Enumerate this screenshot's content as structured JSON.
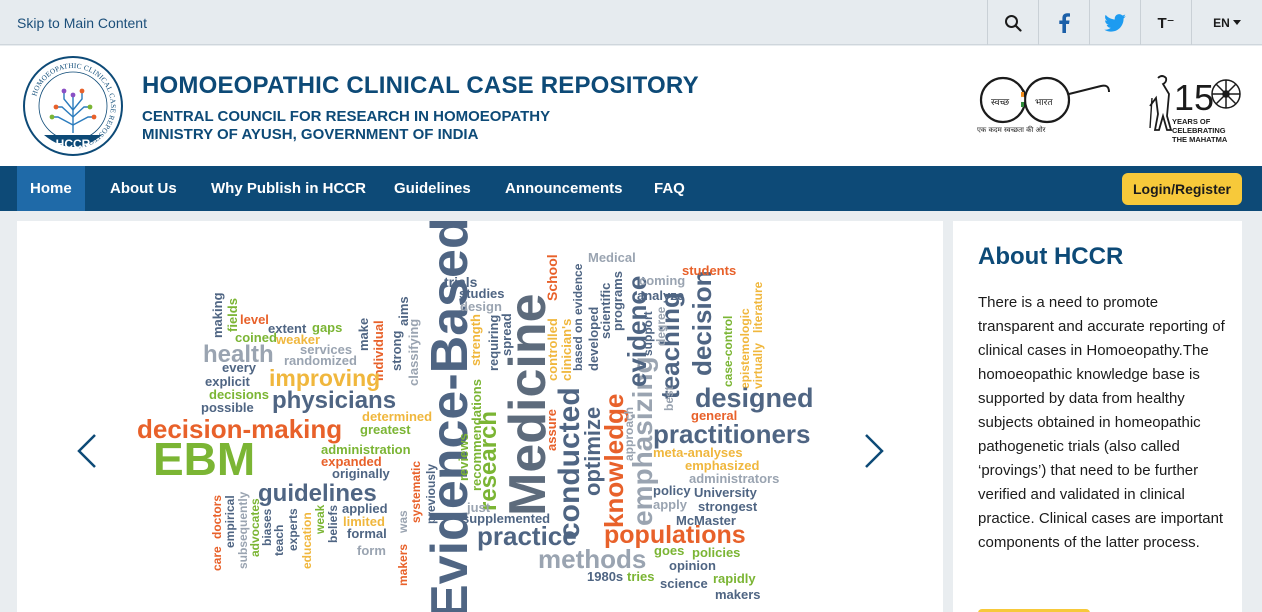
{
  "topbar": {
    "skip_link": "Skip to Main Content",
    "font_size_label": "T⁻",
    "language": "EN",
    "icons": [
      "search-icon",
      "facebook-icon",
      "twitter-icon",
      "font-size-icon",
      "chevron-down-icon"
    ]
  },
  "header": {
    "logo_text": "HCCR",
    "logo_ring_text": "HOMOEOPATHIC CLINICAL CASE REPOSITORY",
    "title": "HOMOEOPATHIC CLINICAL CASE REPOSITORY",
    "subtitle1": "CENTRAL COUNCIL FOR RESEARCH IN HOMOEOPATHY",
    "subtitle2": "MINISTRY OF AYUSH, GOVERNMENT OF INDIA",
    "swachh_left": "स्वच्छ",
    "swachh_right": "भारत",
    "swachh_tagline": "एक कदम स्वच्छता की ओर",
    "gandhi_num": "150",
    "gandhi_text1": "YEARS OF",
    "gandhi_text2": "CELEBRATING",
    "gandhi_text3": "THE MAHATMA"
  },
  "nav": {
    "items": [
      "Home",
      "About Us",
      "Why Publish in HCCR",
      "Guidelines",
      "Announcements",
      "FAQ"
    ],
    "login": "Login/Register"
  },
  "carousel": {
    "words": {
      "w_ebm": "EBM",
      "w_decision_making": "decision-making",
      "w_guidelines": "guidelines",
      "w_physicians": "physicians",
      "w_improving": "improving",
      "w_health": "health",
      "w_evidence_based": "Evidence-Based",
      "w_medicine": "Medicine",
      "w_research": "research",
      "w_practice": "practice",
      "w_methods": "methods",
      "w_populations": "populations",
      "w_practitioners": "practitioners",
      "w_designed": "designed",
      "w_knowledge": "knowledge",
      "w_conducted": "conducted",
      "w_optimize": "optimize",
      "w_emphasizing": "emphasizing",
      "w_evidence": "evidence",
      "w_teaching": "teaching",
      "w_decision": "decision",
      "w_medical": "Medical",
      "w_coming": "coming",
      "w_analyze": "analyze",
      "w_students": "students",
      "w_trials": "trials",
      "w_studies": "studies",
      "w_design": "design",
      "w_school": "School",
      "w_level": "level",
      "w_extent": "extent",
      "w_gaps": "gaps",
      "w_coined": "coined",
      "w_weaker": "weaker",
      "w_services": "services",
      "w_randomized": "randomized",
      "w_every": "every",
      "w_explicit": "explicit",
      "w_decisions": "decisions",
      "w_possible": "possible",
      "w_determined": "determined",
      "w_greatest": "greatest",
      "w_administration": "administration",
      "w_expanded": "expanded",
      "w_originally": "originally",
      "w_applied": "applied",
      "w_limited": "limited",
      "w_formal": "formal",
      "w_form": "form",
      "w_general": "general",
      "w_meta_analyses": "meta-analyses",
      "w_emphasized": "emphasized",
      "w_administrators": "administrators",
      "w_policy": "policy",
      "w_university": "University",
      "w_apply": "apply",
      "w_strongest": "strongest",
      "w_mcmaster": "McMaster",
      "w_goes": "goes",
      "w_policies": "policies",
      "w_opinion": "opinion",
      "w_1980s": "1980s",
      "w_tries": "tries",
      "w_rapidly": "rapidly",
      "w_science": "science",
      "w_makers": "makers",
      "w_just": "just",
      "w_supplemented": "supplemented",
      "w_making": "making",
      "w_fields": "fields",
      "w_individual": "individual",
      "w_make": "make",
      "w_aims": "aims",
      "w_strong": "strong",
      "w_classifying": "classifying",
      "w_reviews": "reviews",
      "w_recommendations": "recommendations",
      "w_requiring": "requiring",
      "w_spread": "spread",
      "w_strength": "strength",
      "w_assure": "assure",
      "w_controlled": "controlled",
      "w_clinicians": "clinician's",
      "w_based_on_evidence": "based on evidence",
      "w_developed": "developed",
      "w_scientific": "scientific",
      "w_programs": "programs",
      "w_approach": "approach",
      "w_best": "best",
      "w_support": "support",
      "w_degree": "degree",
      "w_case_control": "case-control",
      "w_epistemologic": "epistemologic",
      "w_virtually": "virtually",
      "w_literature": "literature",
      "w_care": "care",
      "w_doctors": "doctors",
      "w_empirical": "empirical",
      "w_subsequently": "subsequently",
      "w_advocates": "advocates",
      "w_biases": "biases",
      "w_teach": "teach",
      "w_experts": "experts",
      "w_education": "education",
      "w_weak": "weak",
      "w_beliefs": "beliefs",
      "w_makers_v": "makers",
      "w_was": "was",
      "w_systematic": "systematic",
      "w_previously": "previously"
    }
  },
  "about": {
    "title": "About HCCR",
    "body": "There is a need to promote transparent and accurate reporting of clinical cases in Homoeopathy.The homoeopathic knowledge base is supported by data from healthy subjects obtained in homeopathic pathogenetic trials (also called ‘provings’) that need to be further verified and validated in clinical practice. Clinical cases  are important components of the latter process."
  },
  "colors": {
    "primary": "#0d4a77",
    "nav_active": "#1f6aa8",
    "accent_yellow": "#f7c93a",
    "word_blue": "#4f6583",
    "word_orange": "#e8612a",
    "word_green": "#7bb534",
    "word_yellow": "#f0b73d",
    "word_gray": "#9aa4b1"
  }
}
